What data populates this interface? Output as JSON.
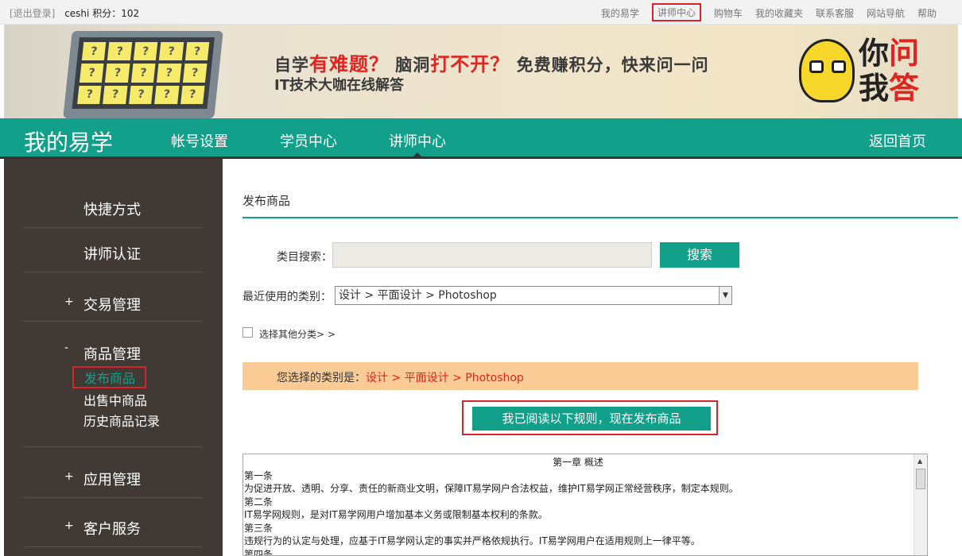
{
  "topbar": {
    "logout": "[退出登录]",
    "user": "ceshi 积分：102",
    "links": [
      "我的易学",
      "讲师中心",
      "购物车",
      "我的收藏夹",
      "联系客服",
      "网站导航",
      "帮助"
    ]
  },
  "banner": {
    "slogan_line1_a": "自学",
    "slogan_line1_b": "有难题？",
    "slogan_line1_c": " 脑洞",
    "slogan_line1_d": "打不开？",
    "slogan_line1_e": " 免费赚积分，快来问一问",
    "slogan_line2": "IT技术大咖在线解答",
    "logo_text_1": "你",
    "logo_text_2": "问",
    "logo_text_3": "我",
    "logo_text_4": "答"
  },
  "nav": {
    "brand": "我的易学",
    "items": [
      "帐号设置",
      "学员中心",
      "讲师中心"
    ],
    "home": "返回首页"
  },
  "sidebar": {
    "items": [
      "快捷方式",
      "讲师认证",
      "交易管理",
      "商品管理",
      "应用管理",
      "客户服务"
    ],
    "plus": "+",
    "minus": "-",
    "subitems": [
      "发布商品",
      "出售中商品",
      "历史商品记录"
    ]
  },
  "main": {
    "title": "发布商品",
    "search_label": "类目搜索：",
    "search_value": "",
    "search_button": "搜索",
    "recent_label": "最近使用的类别：",
    "recent_value": "设计 > 平面设计 > Photoshop",
    "other_category": "选择其他分类> >",
    "selected_label": "您选择的类别是：",
    "selected_value": "设计 > 平面设计 > Photoshop",
    "confirm_button": "我已阅读以下规则，现在发布商品",
    "rules": {
      "chapter": "第一章 概述",
      "lines": [
        "第一条",
        "为促进开放、透明、分享、责任的新商业文明，保障IT易学网户合法权益，维护IT易学网正常经营秩序，制定本规则。",
        "第二条",
        "IT易学网规则，是对IT易学网用户增加基本义务或限制基本权利的条款。",
        "第三条",
        "违规行为的认定与处理，应基于IT易学网认定的事实并严格依规执行。IT易学网用户在适用规则上一律平等。",
        "第四条"
      ]
    }
  }
}
